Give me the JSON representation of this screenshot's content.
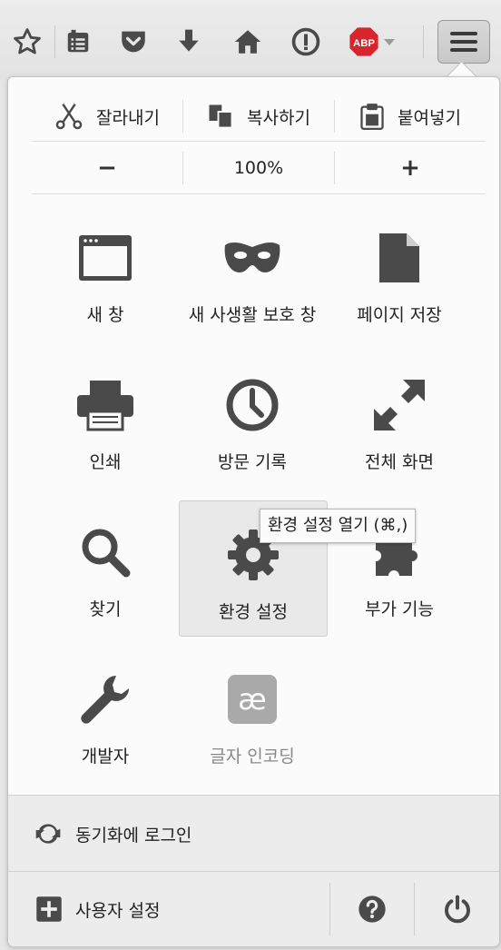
{
  "edit": {
    "cut": "잘라내기",
    "copy": "복사하기",
    "paste": "붙여넣기"
  },
  "zoom": {
    "minus": "−",
    "value": "100%",
    "plus": "+"
  },
  "tiles": [
    {
      "label": "새 창",
      "icon": "new-window-icon"
    },
    {
      "label": "새 사생활 보호 창",
      "icon": "private-mask-icon"
    },
    {
      "label": "페이지 저장",
      "icon": "document-icon"
    },
    {
      "label": "인쇄",
      "icon": "printer-icon"
    },
    {
      "label": "방문 기록",
      "icon": "clock-icon"
    },
    {
      "label": "전체 화면",
      "icon": "fullscreen-arrows-icon"
    },
    {
      "label": "찾기",
      "icon": "magnifier-icon"
    },
    {
      "label": "환경 설정",
      "icon": "gear-icon"
    },
    {
      "label": "부가 기능",
      "icon": "puzzle-icon"
    },
    {
      "label": "개발자",
      "icon": "wrench-icon"
    },
    {
      "label": "글자 인코딩",
      "icon": "ae-encoding-icon"
    }
  ],
  "tooltip": "환경 설정 열기 (⌘,)",
  "sync": {
    "label": "동기화에 로그인"
  },
  "customize": {
    "label": "사용자 설정"
  },
  "toolbar": {
    "abp_label": "ABP"
  },
  "colors": {
    "icon": "#4a4a4a",
    "abp_red": "#d8242c",
    "hover_bg": "#e9e9e9"
  }
}
